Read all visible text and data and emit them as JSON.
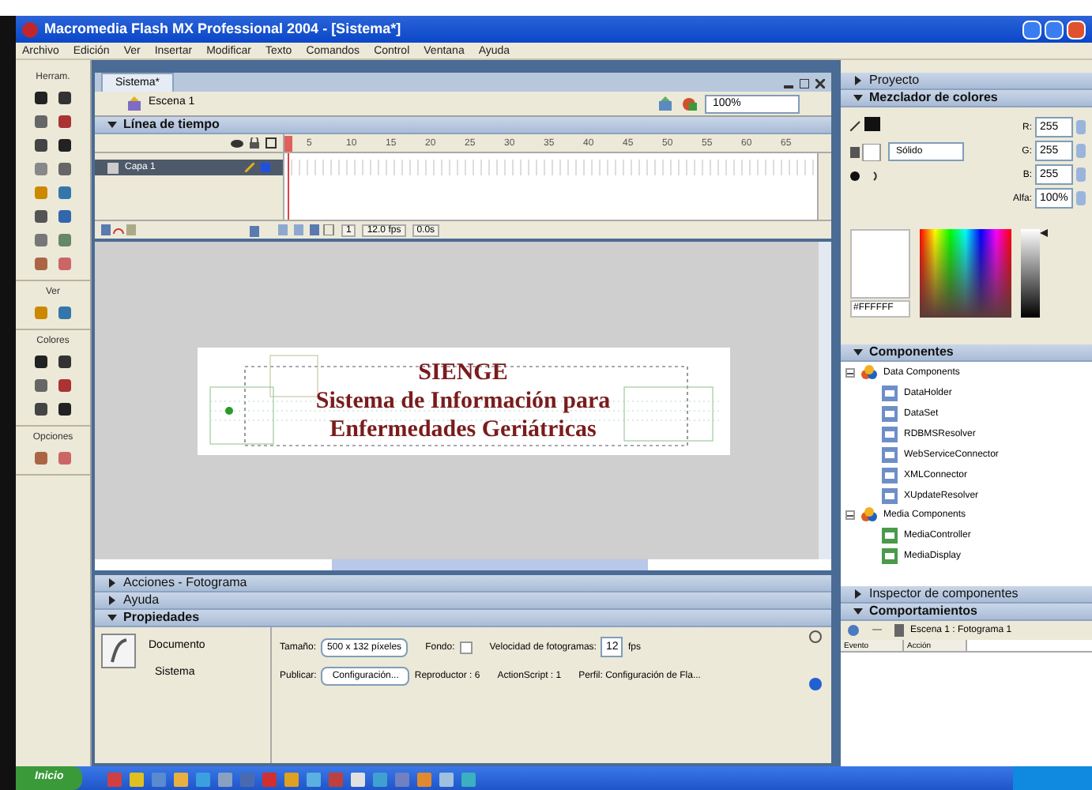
{
  "window": {
    "title": "Macromedia Flash MX Professional 2004 - [Sistema*]"
  },
  "menu": [
    "Archivo",
    "Edición",
    "Ver",
    "Insertar",
    "Modificar",
    "Texto",
    "Comandos",
    "Control",
    "Ventana",
    "Ayuda"
  ],
  "tool_sections": [
    "Herram.",
    "Ver",
    "Colores",
    "Opciones"
  ],
  "document": {
    "tab": "Sistema*",
    "scene": "Escena 1",
    "zoom": "100%"
  },
  "timeline": {
    "title": "Línea de tiempo",
    "expanded": true,
    "frame_numbers": [
      "5",
      "10",
      "15",
      "20",
      "25",
      "30",
      "35",
      "40",
      "45",
      "50",
      "55",
      "60",
      "65"
    ],
    "layers": [
      {
        "name": "Capa 1",
        "selected": true
      }
    ],
    "status": [
      "1",
      "12.0 fps",
      "0.0s"
    ]
  },
  "stage": {
    "lines": [
      "SIENGE",
      "Sistema de Información para",
      "Enfermedades Geriátricas"
    ]
  },
  "bottom_panels": [
    {
      "title": "Acciones - Fotograma",
      "expanded": false
    },
    {
      "title": "Ayuda",
      "expanded": false
    },
    {
      "title": "Propiedades",
      "expanded": true
    }
  ],
  "properties": {
    "type": "Documento",
    "name": "Sistema",
    "size_label": "Tamaño:",
    "size": "500 x 132 píxeles",
    "background_label": "Fondo:",
    "rate_label": "Velocidad de fotogramas:",
    "rate": "12",
    "rate_unit": "fps",
    "publish_label": "Publicar:",
    "publish": "Configuración...",
    "player": "Reproductor : 6",
    "actionscript": "ActionScript : 1",
    "profile": "Perfil: Configuración de Fla..."
  },
  "right_panels": [
    {
      "title": "Proyecto",
      "expanded": false
    },
    {
      "title": "Mezclador de colores",
      "expanded": true
    }
  ],
  "color_mixer": {
    "fill_type": "Sólido",
    "channels": [
      {
        "label": "R:",
        "value": "255"
      },
      {
        "label": "G:",
        "value": "255"
      },
      {
        "label": "B:",
        "value": "255"
      },
      {
        "label": "Alfa:",
        "value": "100%"
      }
    ],
    "hex": "#FFFFFF",
    "brightness": {
      "level": 1
    }
  },
  "components": {
    "title": "Componentes",
    "expanded": true,
    "groups": [
      {
        "name": "Data Components",
        "expanded": true,
        "children": [
          {
            "name": "DataHolder"
          },
          {
            "name": "DataSet"
          },
          {
            "name": "RDBMSResolver"
          },
          {
            "name": "WebServiceConnector"
          },
          {
            "name": "XMLConnector"
          },
          {
            "name": "XUpdateResolver"
          }
        ]
      },
      {
        "name": "Media Components",
        "expanded": true,
        "children": [
          {
            "name": "MediaController"
          },
          {
            "name": "MediaDisplay"
          }
        ]
      }
    ]
  },
  "inspector": {
    "title": "Inspector de componentes",
    "expanded": false
  },
  "behaviors": {
    "title": "Comportamientos",
    "expanded": true,
    "target": "Escena 1 : Fotograma 1",
    "columns": [
      "Evento",
      "Acción"
    ]
  },
  "taskbar": {
    "start": "Inicio"
  }
}
